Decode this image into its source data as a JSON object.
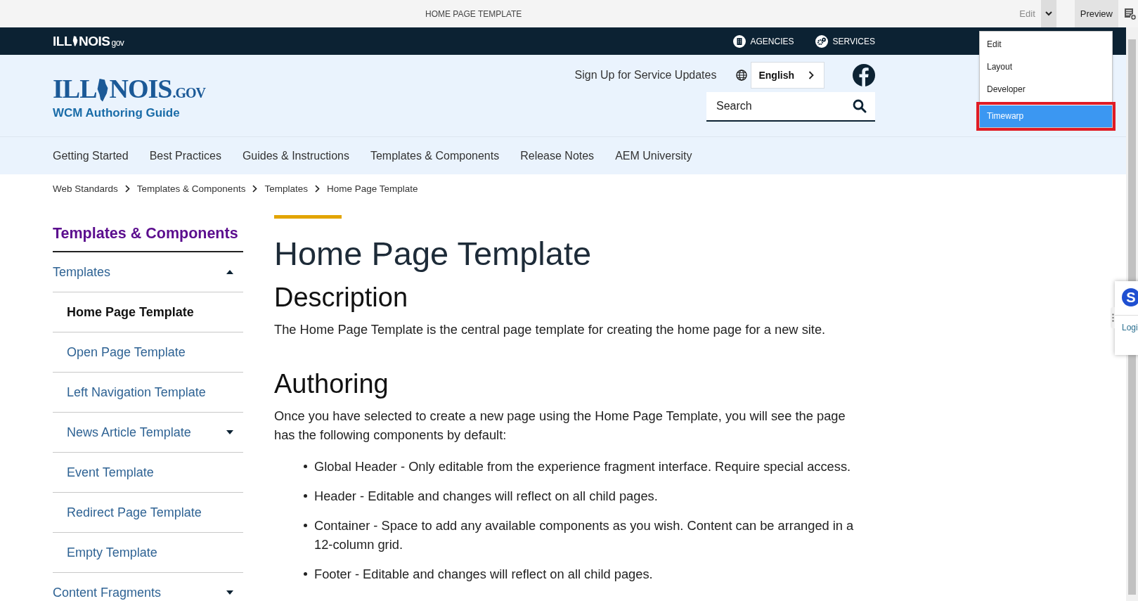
{
  "authoring_bar": {
    "title": "HOME PAGE TEMPLATE",
    "mode_label": "Edit",
    "preview": "Preview"
  },
  "mode_menu": {
    "items": [
      {
        "label": "Edit",
        "selected": false,
        "highlighted": false
      },
      {
        "label": "Layout",
        "selected": false,
        "highlighted": false
      },
      {
        "label": "Developer",
        "selected": false,
        "highlighted": false
      },
      {
        "label": "Timewarp",
        "selected": true,
        "highlighted": true
      }
    ]
  },
  "top_bar": {
    "logo": {
      "start": "ILL",
      "end": "NOIS",
      "suffix": "gov"
    },
    "links": [
      {
        "label": "AGENCIES",
        "kind": "building"
      },
      {
        "label": "SERVICES",
        "kind": "gears"
      }
    ]
  },
  "header": {
    "logo": {
      "start": "ILL",
      "end": "NOIS",
      "suffix": ".GOV",
      "subtitle": "WCM Authoring Guide"
    },
    "signup": "Sign Up for Service Updates",
    "language": "English",
    "search": {
      "placeholder": "Search"
    }
  },
  "nav": [
    "Getting Started",
    "Best Practices",
    "Guides & Instructions",
    "Templates & Components",
    "Release Notes",
    "AEM University"
  ],
  "breadcrumbs": [
    "Web Standards",
    "Templates & Components",
    "Templates",
    "Home Page Template"
  ],
  "sidebar": {
    "title": "Templates & Components",
    "items": [
      {
        "label": "Templates",
        "expanded": true,
        "selected": false,
        "children": [
          {
            "label": "Home Page Template",
            "selected": true
          },
          {
            "label": "Open Page Template",
            "selected": false
          },
          {
            "label": "Left Navigation Template",
            "selected": false
          },
          {
            "label": "News Article Template",
            "selected": false,
            "expanded": false
          },
          {
            "label": "Event Template",
            "selected": false
          },
          {
            "label": "Redirect Page Template",
            "selected": false
          },
          {
            "label": "Empty Template",
            "selected": false
          }
        ]
      },
      {
        "label": "Content Fragments",
        "expanded": false,
        "selected": false
      }
    ]
  },
  "content": {
    "title": "Home Page Template",
    "sections": [
      {
        "heading": "Description",
        "paragraphs": [
          "The Home Page Template is the central page template for creating the home page for a new site."
        ]
      },
      {
        "heading": "Authoring",
        "paragraphs": [
          "Once you have selected to create a new page using the Home Page Template, you will see the page has the following components by default:"
        ],
        "bullets": [
          "Global Header - Only editable from the experience fragment interface. Require special access.",
          "Header - Editable and changes will reflect on all child pages.",
          "Container - Space to add any available components as you wish. Content can be arranged in a 12-column grid.",
          "Footer - Editable and changes will reflect on all child pages."
        ]
      }
    ]
  },
  "side_widget": {
    "badge": "S",
    "link": "Logi"
  }
}
